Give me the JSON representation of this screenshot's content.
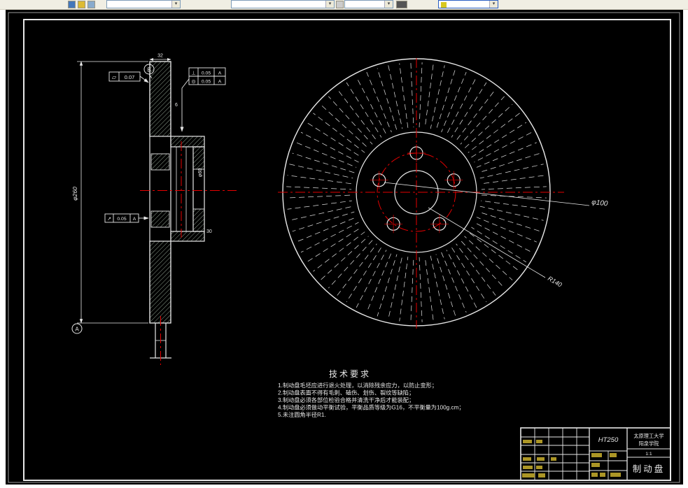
{
  "colors": {
    "canvas": "#000000",
    "drawing_line": "#e8e8e8",
    "centerline_red": "#e60000",
    "hatch_green": "#cfe6cf",
    "annotation_yellow": "#d8b800",
    "toolbar_bg": "#f0eee3"
  },
  "icons": {
    "combo_arrow": "▾"
  },
  "tech": {
    "title": "技术要求",
    "items": [
      "1.制动盘毛坯应进行退火处理，以消除残余应力，以防止变形；",
      "2.制动盘表面不得有毛刺、磕伤、划伤、裂纹等缺陷；",
      "3.制动盘必须各部位检验合格并清洗干净后才能装配；",
      "4.制动盘必须做动平衡试验，平衡品质等级为G16，不平衡量为100g.cm；",
      "5.未注圆角半径R1."
    ]
  },
  "disc": {
    "labels": {
      "bolt_circle": "φ100",
      "outer": "R140"
    }
  },
  "section": {
    "datum_a": "A",
    "datum_b": "B",
    "fcf_flat": {
      "symbol": "▱",
      "value": "0.07"
    },
    "fcf_right": {
      "rows": [
        {
          "symbol": "⊥",
          "value": "0.05",
          "datum": "A"
        },
        {
          "symbol": "◎",
          "value": "0.05",
          "datum": "A"
        }
      ]
    },
    "fcf_mid": {
      "symbol": "↗",
      "value": "0.05",
      "datum": "A"
    },
    "dims": {
      "outer_dia": "φ260",
      "plate": "32",
      "vent": "6",
      "hub_dia": "φ60",
      "hat_depth": "30"
    }
  },
  "titleblock": {
    "material": "HT250",
    "school_line1": "太原理工大学",
    "school_line2": "阳泉学院",
    "scale": "1:1",
    "part_name": "制动盘"
  }
}
